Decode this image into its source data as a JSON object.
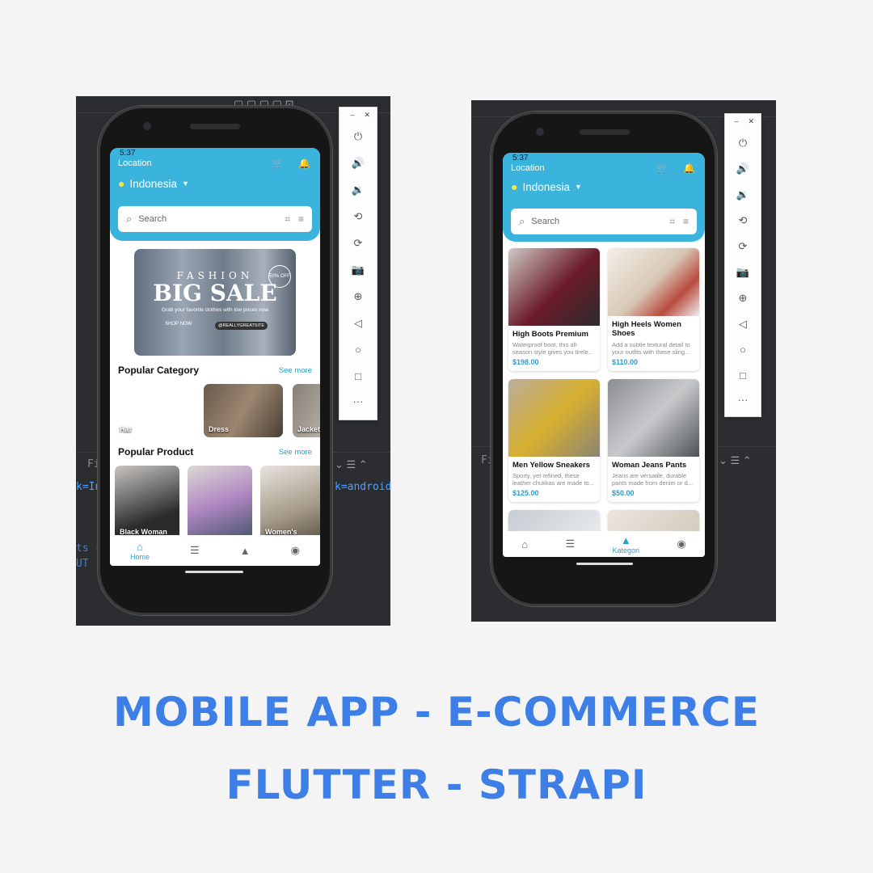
{
  "colors": {
    "accent": "#3bb4dd",
    "link": "#2a9fd0",
    "title": "#3d7fe6",
    "price": "#2a9fd0"
  },
  "left": {
    "status_time": "5:37",
    "location_label": "Location",
    "country": "Indonesia",
    "search_placeholder": "Search",
    "banner": {
      "word1": "FASHION",
      "word2": "BIG SALE",
      "subtitle": "Grab your favorite clothes with low prices now",
      "button": "SHOP NOW",
      "handle": "@REALLYGREATSITE",
      "badge": "50% OFF"
    },
    "popular_category": {
      "title": "Popular Category",
      "more": "See more",
      "items": [
        "Hat",
        "Dress",
        "Jacket"
      ]
    },
    "popular_product": {
      "title": "Popular Product",
      "more": "See more",
      "items": [
        "Black Woman",
        "",
        "Women's"
      ]
    },
    "nav": [
      "Home",
      "",
      "",
      ""
    ],
    "code_lines": [
      "k=In",
      "ts r",
      "UT :",
      "k=android",
      "Fil"
    ]
  },
  "right": {
    "status_time": "5:37",
    "location_label": "Location",
    "country": "Indonesia",
    "search_placeholder": "Search",
    "products": [
      {
        "name": "High Boots Premium",
        "desc": "Waterproof boot, this all-season style gives you tirele...",
        "price": "$198.00"
      },
      {
        "name": "High Heels Women Shoes",
        "desc": "Add a subtle textural detail to your outfits with these sling...",
        "price": "$110.00"
      },
      {
        "name": "Men Yellow Sneakers",
        "desc": "Sporty, yet refined, these leather chukkas are made to...",
        "price": "$125.00"
      },
      {
        "name": "Woman Jeans Pants",
        "desc": "Jeans are versatile, durable pants made from denim or d...",
        "price": "$50.00"
      }
    ],
    "nav": [
      "",
      "",
      "Kategori",
      ""
    ],
    "code_lines": [
      "Fil"
    ]
  },
  "icons": {
    "power": "power-icon",
    "volume_up": "volume-up-icon",
    "volume_down": "volume-down-icon",
    "rotate_left": "rotate-left-icon",
    "rotate_right": "rotate-right-icon",
    "camera": "camera-icon",
    "zoom": "zoom-in-icon",
    "back": "back-icon",
    "home": "home-icon",
    "overview": "overview-icon",
    "more": "more-icon"
  },
  "headline": {
    "line1": "MOBILE APP - E-COMMERCE",
    "line2": "FLUTTER - STRAPI"
  }
}
